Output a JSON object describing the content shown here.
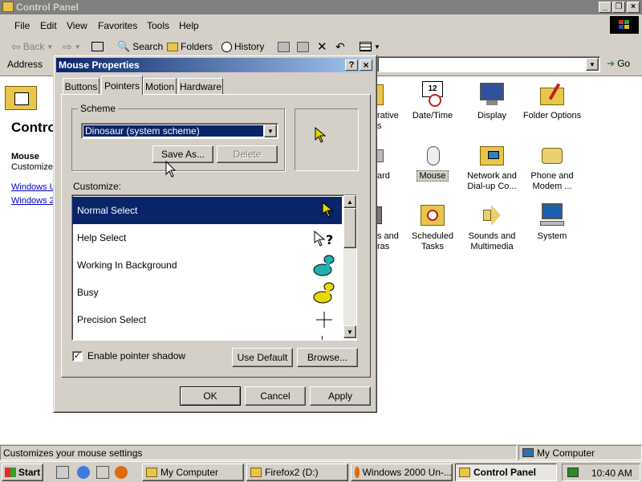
{
  "explorer": {
    "title": "Control Panel",
    "menu": [
      "File",
      "Edit",
      "View",
      "Favorites",
      "Tools",
      "Help"
    ],
    "toolbar": {
      "back": "Back",
      "search": "Search",
      "folders": "Folders",
      "history": "History"
    },
    "address_label": "Address",
    "go_label": "Go",
    "left_pane": {
      "heading": "Control",
      "selected_name": "Mouse",
      "selected_desc": "Customizes",
      "link1": "Windows U",
      "link2": "Windows 2"
    },
    "icons": [
      {
        "label": "rative\ns"
      },
      {
        "label": "Date/Time"
      },
      {
        "label": "Display"
      },
      {
        "label": "Folder Options"
      },
      {
        "label": "ard"
      },
      {
        "label": "Mouse"
      },
      {
        "label": "Network and\nDial-up Co..."
      },
      {
        "label": "Phone and\nModem ..."
      },
      {
        "label": "s and\nras"
      },
      {
        "label": "Scheduled\nTasks"
      },
      {
        "label": "Sounds and\nMultimedia"
      },
      {
        "label": "System"
      }
    ],
    "status_text": "Customizes your mouse settings",
    "status_zone": "My Computer"
  },
  "taskbar": {
    "start": "Start",
    "tasks": [
      "My Computer",
      "Firefox2 (D:)",
      "Windows 2000 Un-...",
      "Control Panel"
    ],
    "clock": "10:40 AM"
  },
  "dialog": {
    "title": "Mouse Properties",
    "help_btn": "?",
    "close_btn": "×",
    "tabs": [
      "Buttons",
      "Pointers",
      "Motion",
      "Hardware"
    ],
    "scheme_label": "Scheme",
    "scheme_value": "Dinosaur (system scheme)",
    "save_as": "Save As...",
    "delete": "Delete",
    "customize_label": "Customize:",
    "pointers": [
      "Normal Select",
      "Help Select",
      "Working In Background",
      "Busy",
      "Precision Select"
    ],
    "shadow_label": "Enable pointer shadow",
    "use_default": "Use Default",
    "browse": "Browse...",
    "ok": "OK",
    "cancel": "Cancel",
    "apply": "Apply"
  },
  "colors": {
    "selection": "#0a246a",
    "title_active": "#0a246a",
    "title_inactive": "#808080"
  }
}
